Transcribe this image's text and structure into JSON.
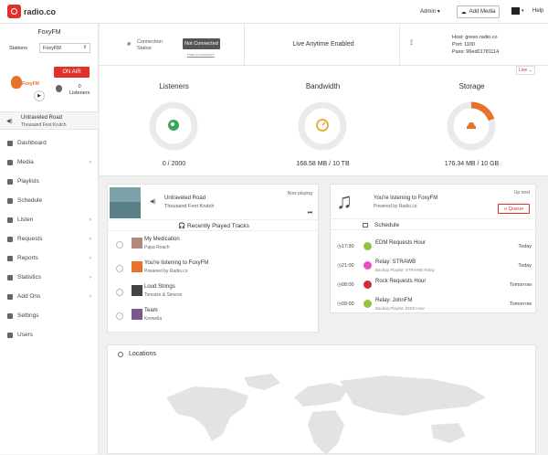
{
  "topbar": {
    "logo_text": "radio.co",
    "admin_label": "Admin",
    "add_media_label": "Add Media",
    "help_label": "Help"
  },
  "sidebar": {
    "station_name": "FoxyFM",
    "stations_label": "Stations",
    "station_select": "FoxyFM",
    "avatar_text": "FoxyFM",
    "on_air": "ON AIR",
    "listeners_count": "0",
    "listeners_label": "Listeners",
    "now_playing_title": "Untraveled Road",
    "now_playing_artist": "Thousand Foot Krutch",
    "nav": [
      {
        "label": "Dashboard",
        "chevron": false
      },
      {
        "label": "Media",
        "chevron": true
      },
      {
        "label": "Playlists",
        "chevron": false
      },
      {
        "label": "Schedule",
        "chevron": false
      },
      {
        "label": "Listen",
        "chevron": true
      },
      {
        "label": "Requests",
        "chevron": true
      },
      {
        "label": "Reports",
        "chevron": true
      },
      {
        "label": "Statistics",
        "chevron": true
      },
      {
        "label": "Add Ons",
        "chevron": true
      },
      {
        "label": "Settings",
        "chevron": false
      },
      {
        "label": "Users",
        "chevron": false
      }
    ]
  },
  "status": {
    "connection_label_1": "Connection",
    "connection_label_2": "Status",
    "not_connected": "Not Connected",
    "how_to_connect": "How to connect?",
    "anytime": "Live Anytime Enabled",
    "host": "Host: green.radio.co",
    "port": "Port: 1100",
    "pass": "Pass: 96ed01781114"
  },
  "stats": {
    "live_dropdown": "Live",
    "listeners": {
      "title": "Listeners",
      "value": "0 / 2000",
      "fill": 0.0
    },
    "bandwidth": {
      "title": "Bandwidth",
      "value": "168.58 MB / 10 TB",
      "fill": 0.0
    },
    "storage": {
      "title": "Storage",
      "value": "176.34 MB / 10 GB",
      "fill": 0.2
    }
  },
  "now_playing": {
    "label": "Now playing",
    "title": "Untraveled Road",
    "artist": "Thousand Foot Krutch"
  },
  "recent": {
    "heading": "Recently Played Tracks",
    "tracks": [
      {
        "title": "My Medication",
        "artist": "Papa Roach"
      },
      {
        "title": "You're listening to FoxyFM",
        "artist": "Powered by Radio.co"
      },
      {
        "title": "Loud Strings",
        "artist": "Tomsize & Simeon"
      },
      {
        "title": "Team",
        "artist": "Krewella"
      }
    ]
  },
  "up_next": {
    "label": "Up next",
    "title": "You're listening to FoxyFM",
    "subtitle": "Powered by Radio.co",
    "queue_label": "Queue"
  },
  "schedule": {
    "heading": "Schedule",
    "items": [
      {
        "time": "17:30",
        "title": "EDM Requests Hour",
        "sub": "",
        "day": "Today",
        "color": "#8dc63f"
      },
      {
        "time": "21:00",
        "title": "Relay: STRAWB",
        "sub": "Backup Playlist: STRAWB Relay",
        "day": "Today",
        "color": "#e84fc3"
      },
      {
        "time": "08:00",
        "title": "Rock Requests Hour",
        "sub": "",
        "day": "Tomorrow",
        "color": "#d12f2f"
      },
      {
        "time": "09:00",
        "title": "Relay: JohnFM",
        "sub": "Backup Playlist: EDM Hour",
        "day": "Tomorrow",
        "color": "#8dc63f"
      }
    ]
  },
  "locations": {
    "heading": "Locations"
  },
  "colors": {
    "accent": "#e0312d",
    "listeners_icon": "#3aa65a",
    "bandwidth_icon": "#f0a52a",
    "storage_icon": "#e8712c"
  }
}
